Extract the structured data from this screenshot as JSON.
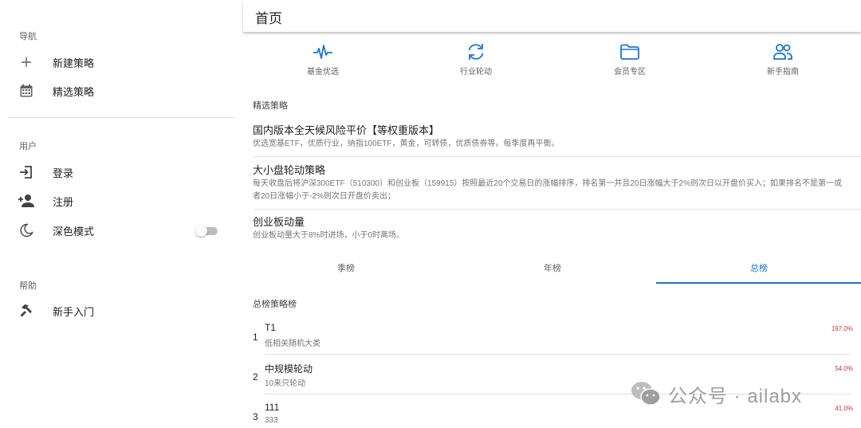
{
  "sidebar": {
    "sections": {
      "nav": "导航",
      "user": "用户",
      "help": "帮助"
    },
    "items": [
      {
        "label": "新建策略",
        "icon": "plus-icon"
      },
      {
        "label": "精选策略",
        "icon": "calendar-icon"
      },
      {
        "label": "登录",
        "icon": "login-icon"
      },
      {
        "label": "注册",
        "icon": "person-add-icon"
      },
      {
        "label": "深色模式",
        "icon": "moon-icon"
      },
      {
        "label": "新手入门",
        "icon": "hammer-icon"
      }
    ],
    "dark_mode": false
  },
  "header": {
    "title": "首页"
  },
  "quick_links": [
    {
      "label": "基金优选",
      "icon": "pulse-icon"
    },
    {
      "label": "行业轮动",
      "icon": "sync-icon"
    },
    {
      "label": "会员专区",
      "icon": "folder-icon"
    },
    {
      "label": "新手指南",
      "icon": "people-icon"
    }
  ],
  "featured": {
    "heading": "精选策略",
    "items": [
      {
        "title": "国内版本全天候风险平价【等权重版本】",
        "desc": "优选宽基ETF，优质行业，纳指100ETF，黄金，可转债，优质债券等。每季度再平衡。"
      },
      {
        "title": "大小盘轮动策略",
        "desc": "每天收盘后将沪深300ETF（510300）和创业板（159915）按照最近20个交易日的涨幅排序，排名第一并且20日涨幅大于2%则次日以开盘价买入；如果排名不是第一或者20日涨幅小于-2%则次日开盘价卖出；"
      },
      {
        "title": "创业板动量",
        "desc": "创业板动量大于8%时进场，小于0时离场。"
      }
    ]
  },
  "tabs": [
    {
      "label": "季榜"
    },
    {
      "label": "年榜"
    },
    {
      "label": "总榜"
    }
  ],
  "active_tab": 2,
  "ranking": {
    "heading": "总榜策略榜",
    "rows": [
      {
        "rank": "1",
        "name": "T1",
        "desc": "低相关随机大类",
        "value": "197.0%"
      },
      {
        "rank": "2",
        "name": "中规模轮动",
        "desc": "10来只轮动",
        "value": "54.0%"
      },
      {
        "rank": "3",
        "name": "111",
        "desc": "333",
        "value": "41.0%"
      }
    ]
  },
  "watermark": {
    "text": "公众号 · ailabx",
    "icon": "wechat-icon"
  },
  "colors": {
    "accent": "#1976d2",
    "positive": "#d32f2f",
    "icon_gray": "#616161"
  }
}
